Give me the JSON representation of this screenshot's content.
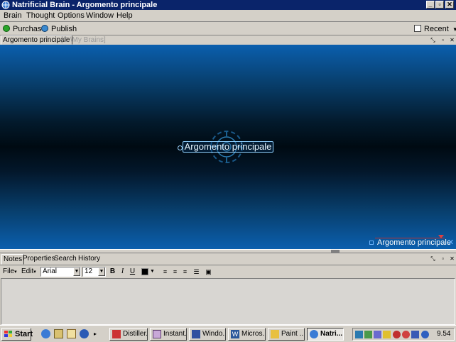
{
  "window": {
    "title": "Natrificial Brain - Argomento principale",
    "minimize": "_",
    "maximize": "▫",
    "close": "✕"
  },
  "menu": [
    "Brain",
    "Thought",
    "Options",
    "Window",
    "Help"
  ],
  "toolbar": {
    "purchase": "Purchase",
    "publish": "Publish",
    "recent": "Recent"
  },
  "tabs": {
    "active": "Argomento principale",
    "path": "[C:\\My Brains]"
  },
  "canvas": {
    "central_thought": "Argomento principale",
    "plex_label": "Argomento principale"
  },
  "notes": {
    "tabs": [
      "Notes",
      "Properties",
      "Search",
      "History"
    ],
    "file_menu": "File",
    "edit_menu": "Edit",
    "font": "Arial",
    "size": "12",
    "bold": "B",
    "italic": "I",
    "underline": "U"
  },
  "taskbar": {
    "start": "Start",
    "tasks": [
      "Distiller...",
      "Instant...",
      "Windo...",
      "Micros...",
      "Paint ...",
      "Natri..."
    ],
    "clock": "9.54"
  }
}
